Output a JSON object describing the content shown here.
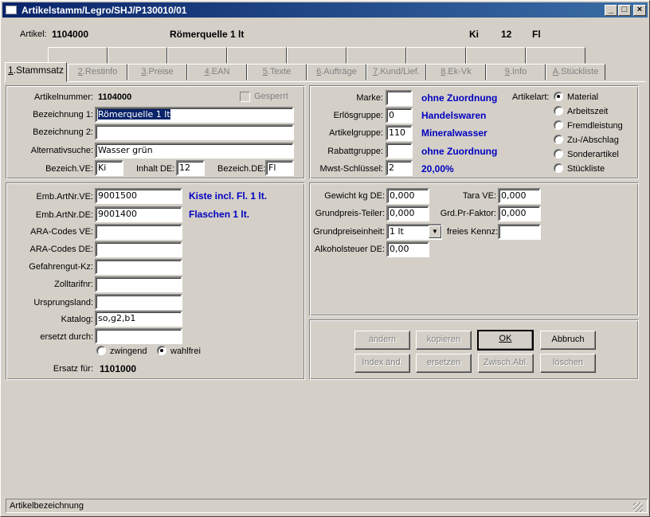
{
  "window": {
    "title": "Artikelstamm/Legro/SHJ/P130010/01",
    "minimize": "_",
    "maximize": "□",
    "close": "×"
  },
  "header": {
    "artikel_label": "Artikel:",
    "artikel_nr": "1104000",
    "artikel_name": "Römerquelle 1 lt",
    "unit_ve": "Ki",
    "inhalt": "12",
    "unit_de": "Fl"
  },
  "tabs": [
    {
      "key": "1",
      "label": "Stammsatz"
    },
    {
      "key": "2",
      "label": "Restinfo"
    },
    {
      "key": "3",
      "label": "Preise"
    },
    {
      "key": "4",
      "label": "EAN"
    },
    {
      "key": "5",
      "label": "Texte"
    },
    {
      "key": "6",
      "label": "Aufträge"
    },
    {
      "key": "7",
      "label": "Kund/Lief."
    },
    {
      "key": "8",
      "label": "Ek-Vk"
    },
    {
      "key": "9",
      "label": "Info"
    },
    {
      "key": "A",
      "label": "Stückliste"
    }
  ],
  "basis": {
    "artikelnummer_label": "Artikelnummer:",
    "artikelnummer": "1104000",
    "gesperrt_label": "Gesperrt",
    "bezeichnung1_label": "Bezeichnung 1:",
    "bezeichnung1": "Römerquelle 1 lt",
    "bezeichnung2_label": "Bezeichnung 2:",
    "bezeichnung2": "",
    "alternativsuche_label": "Alternativsuche:",
    "alternativsuche": "Wasser grün",
    "bezeich_ve_label": "Bezeich.VE:",
    "bezeich_ve": "Ki",
    "inhalt_de_label": "Inhalt DE:",
    "inhalt_de": "12",
    "bezeich_de_label": "Bezeich.DE:",
    "bezeich_de": "Fl"
  },
  "klassifikation": {
    "marke_label": "Marke:",
    "marke": "",
    "marke_text": "ohne Zuordnung",
    "erloesgruppe_label": "Erlösgruppe:",
    "erloesgruppe": "0",
    "erloesgruppe_text": "Handelswaren",
    "artikelgruppe_label": "Artikelgruppe:",
    "artikelgruppe": "110",
    "artikelgruppe_text": "Mineralwasser",
    "rabattgruppe_label": "Rabattgruppe:",
    "rabattgruppe": "",
    "rabattgruppe_text": "ohne Zuordnung",
    "mwst_label": "Mwst-Schlüssel:",
    "mwst": "2",
    "mwst_text": "20,00%",
    "artikelart_label": "Artikelart:",
    "artikelart_options": [
      "Material",
      "Arbeitszeit",
      "Fremdleistung",
      "Zu-/Abschlag",
      "Sonderartikel",
      "Stückliste"
    ],
    "artikelart_selected": "Material"
  },
  "codes": {
    "emb_ve_label": "Emb.ArtNr.VE:",
    "emb_ve": "9001500",
    "emb_ve_text": "Kiste incl. Fl. 1 lt.",
    "emb_de_label": "Emb.ArtNr.DE:",
    "emb_de": "9001400",
    "emb_de_text": "Flaschen 1 lt.",
    "ara_ve_label": "ARA-Codes VE:",
    "ara_ve": "",
    "ara_de_label": "ARA-Codes DE:",
    "ara_de": "",
    "gefahrengut_label": "Gefahrengut-Kz:",
    "gefahrengut": "",
    "zolltarif_label": "Zolltarifnr:",
    "zolltarif": "",
    "ursprungsland_label": "Ursprungsland:",
    "ursprungsland": "",
    "katalog_label": "Katalog:",
    "katalog": "so,g2,b1",
    "ersetzt_label": "ersetzt durch:",
    "ersetzt": "",
    "zwingend_label": "zwingend",
    "wahlfrei_label": "wahlfrei",
    "ersatz_selected": "wahlfrei",
    "ersatz_fuer_label": "Ersatz für:",
    "ersatz_fuer": "1101000"
  },
  "gewicht": {
    "gewicht_label": "Gewicht kg DE:",
    "gewicht": "0,000",
    "tara_label": "Tara VE:",
    "tara": "0,000",
    "gp_teiler_label": "Grundpreis-Teiler:",
    "gp_teiler": "0,000",
    "grd_faktor_label": "Grd.Pr-Faktor:",
    "grd_faktor": "0,000",
    "gp_einheit_label": "Grundpreiseinheit:",
    "gp_einheit": "1 lt",
    "freies_kennz_label": "freies Kennz:",
    "freies_kennz": "",
    "alkohol_label": "Alkoholsteuer DE:",
    "alkohol": "0,00"
  },
  "buttons": {
    "aendern": "ändern",
    "kopieren": "kopieren",
    "ok": "OK",
    "abbruch": "Abbruch",
    "index": "Index änd.",
    "ersetzen": "ersetzen",
    "zwisch": "Zwisch.Abl.",
    "loeschen": "löschen"
  },
  "status": {
    "text": "Artikelbezeichnung"
  }
}
